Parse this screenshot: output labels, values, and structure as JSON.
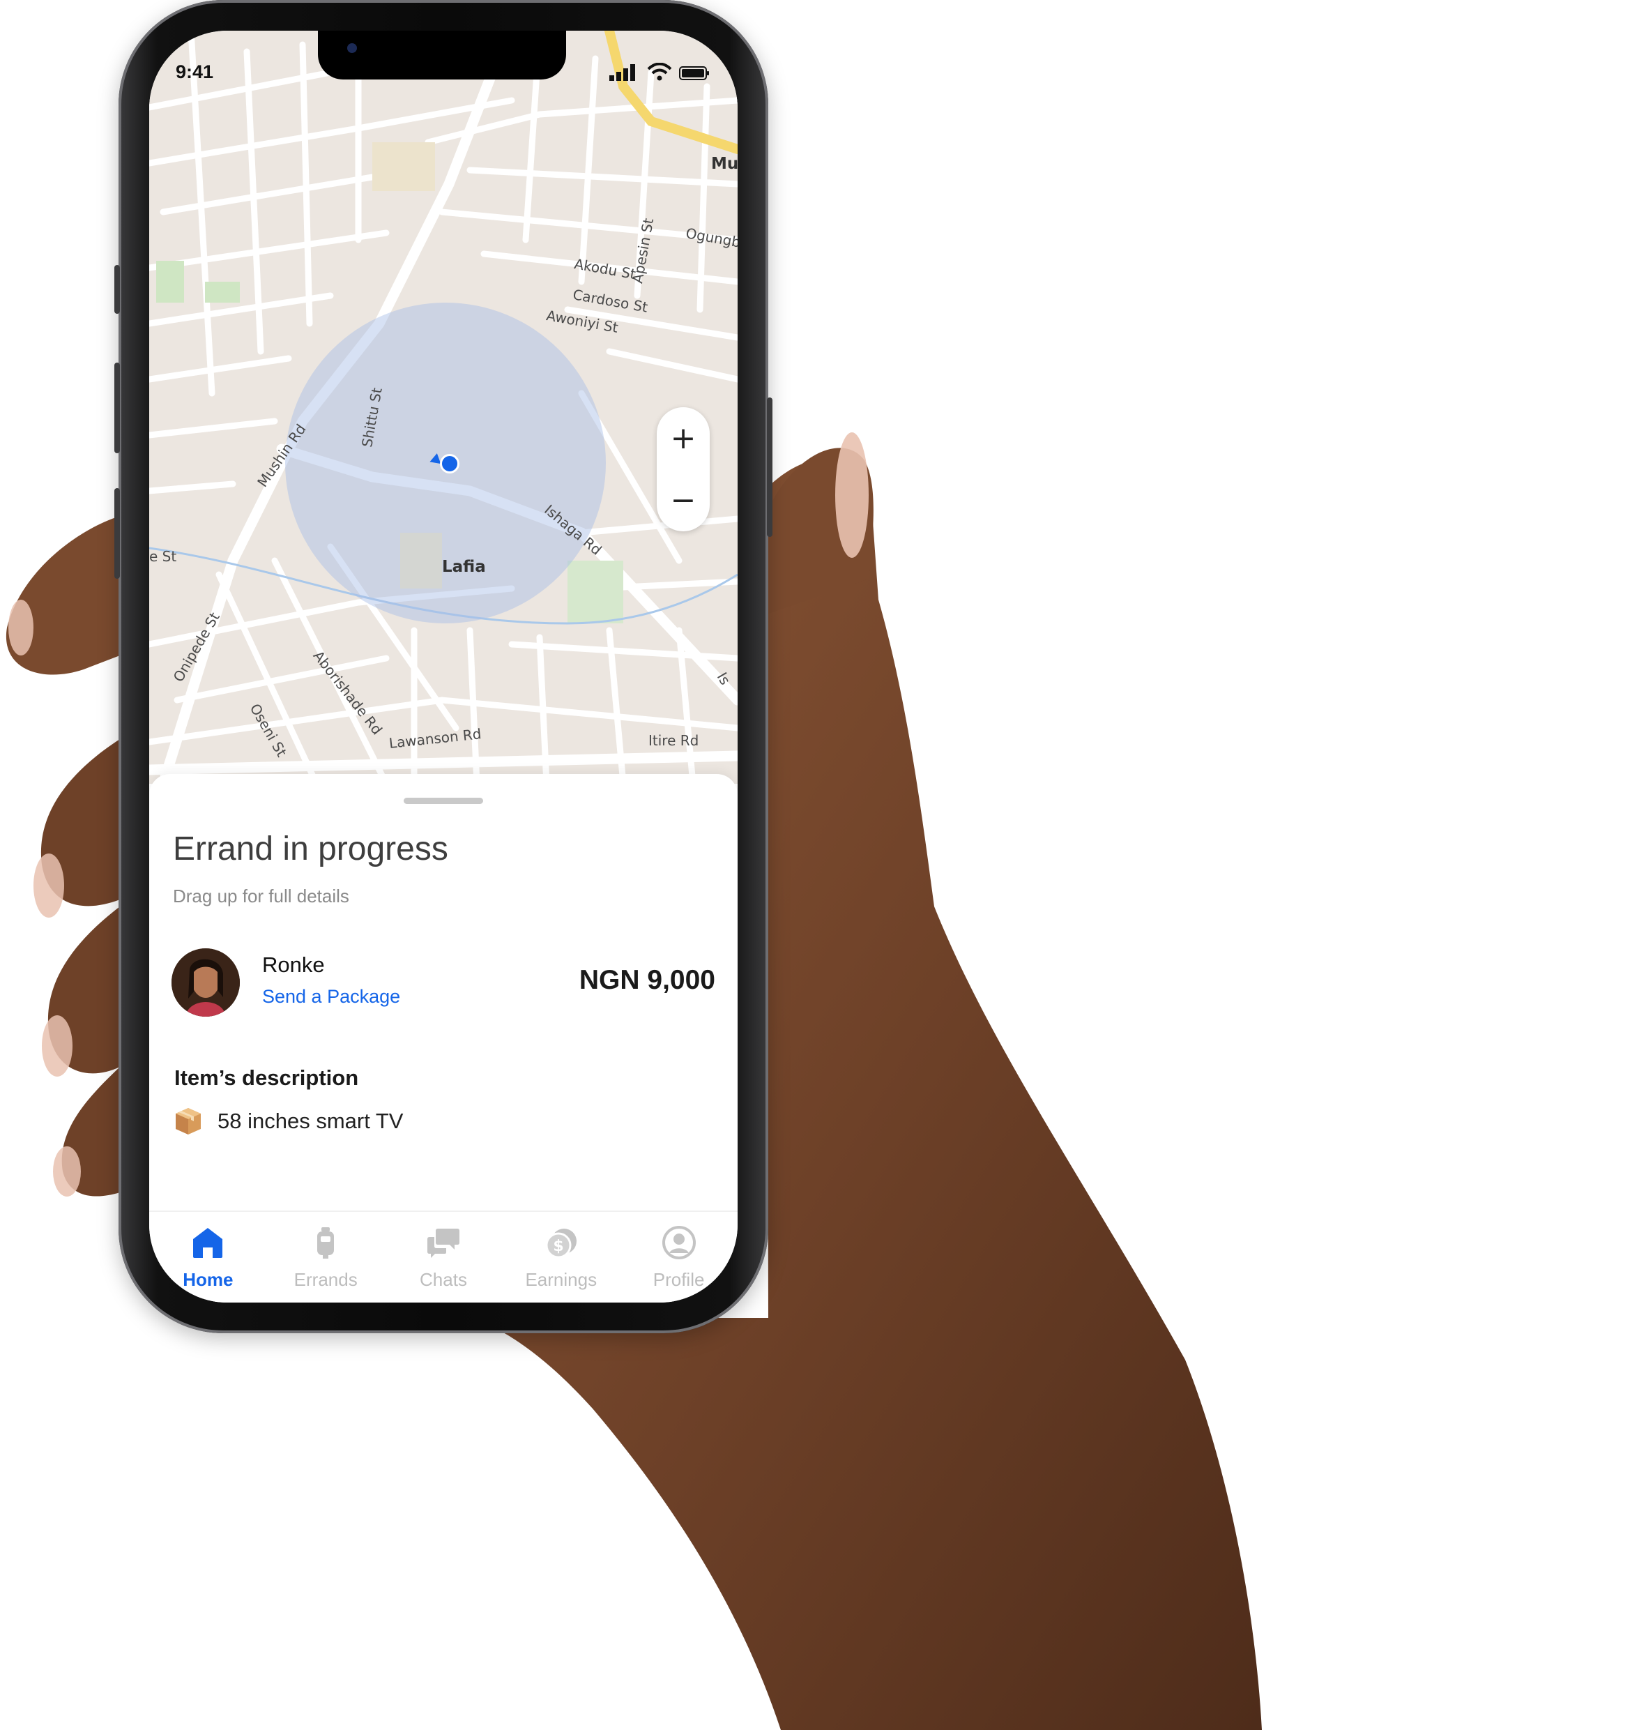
{
  "status_bar": {
    "time": "9:41"
  },
  "map": {
    "street_labels": [
      "Akodu St",
      "Cardoso St",
      "Awoniyi St",
      "Apesin St",
      "Ogungb",
      "Mu",
      "Shittu St",
      "Mushin Rd",
      "Ishaga Rd",
      "e St",
      "Onipede St",
      "Aborishade Rd",
      "Oseni St",
      "Lawanson Rd",
      "Itire Rd",
      "Is"
    ],
    "area_label": "Lafia",
    "zoom_in_label": "+",
    "zoom_out_label": "−"
  },
  "sheet": {
    "title": "Errand in progress",
    "subtitle": "Drag up for full details",
    "customer": {
      "name": "Ronke",
      "errand_type": "Send a Package",
      "price": "NGN 9,000"
    },
    "item_heading": "Item’s description",
    "item_description": "58 inches smart TV"
  },
  "tabs": [
    {
      "label": "Home",
      "icon": "home-icon",
      "active": true
    },
    {
      "label": "Errands",
      "icon": "errands-icon",
      "active": false
    },
    {
      "label": "Chats",
      "icon": "chats-icon",
      "active": false
    },
    {
      "label": "Earnings",
      "icon": "earnings-icon",
      "active": false
    },
    {
      "label": "Profile",
      "icon": "profile-icon",
      "active": false
    }
  ],
  "colors": {
    "accent": "#1565e8",
    "map_background": "#ece6e0",
    "highlighted_road": "#f5d76e",
    "radius_overlay": "#c9d6ee",
    "inactive_tab": "#bdbdbd"
  }
}
